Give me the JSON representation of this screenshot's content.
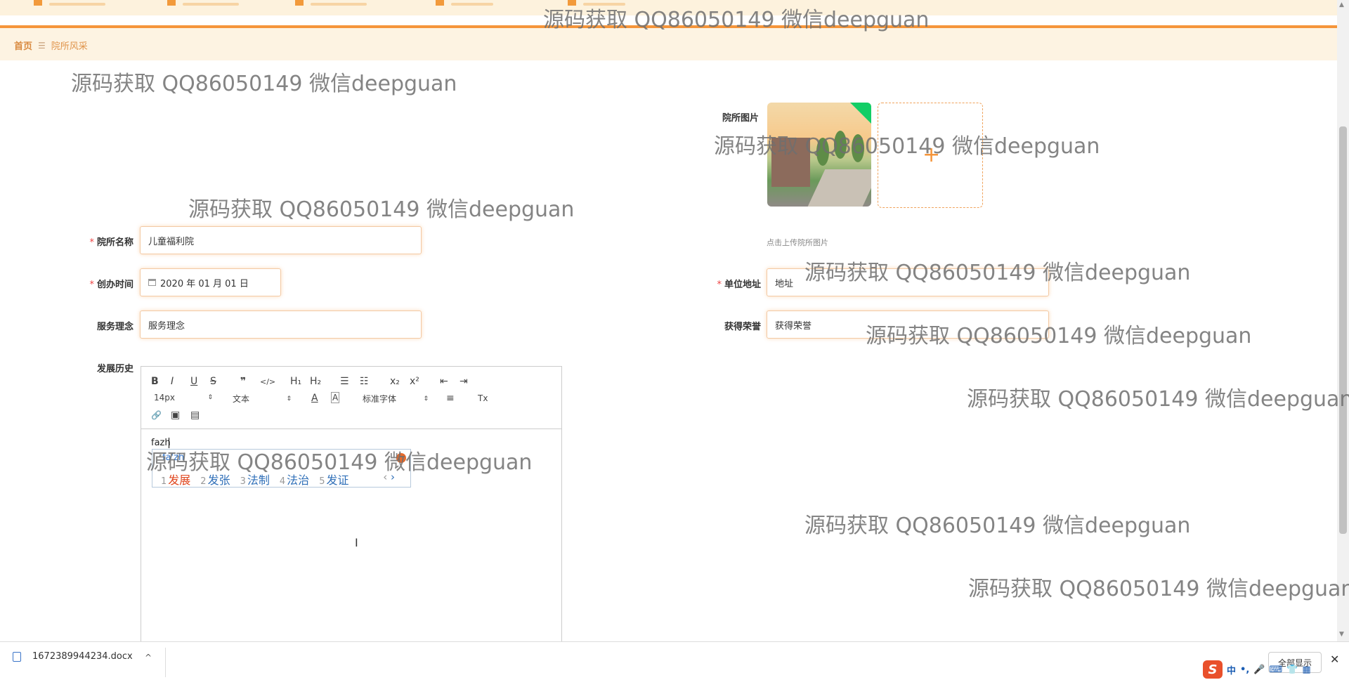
{
  "nav": {
    "items": [
      "",
      "",
      "",
      "",
      ""
    ]
  },
  "breadcrumb": {
    "home": "首页",
    "separator": "☰",
    "current": "院所风采"
  },
  "form": {
    "name": {
      "label": "院所名称",
      "value": "儿童福利院",
      "required": "*"
    },
    "founded": {
      "label": "创办时间",
      "value": "2020 年 01 月 01 日",
      "required": "*"
    },
    "address": {
      "label": "单位地址",
      "value": "地址",
      "required": "*"
    },
    "philosophy": {
      "label": "服务理念",
      "value": "服务理念"
    },
    "honors": {
      "label": "获得荣誉",
      "value": "获得荣誉"
    },
    "photo": {
      "label": "院所图片",
      "tip": "点击上传院所图片",
      "add": "+"
    },
    "history": {
      "label": "发展历史",
      "content": "fazh"
    }
  },
  "editor": {
    "toolbar": {
      "bold": "B",
      "italic": "I",
      "underline": "U",
      "strike": "S",
      "quote": "❞",
      "code": "</>",
      "h1": "H₁",
      "h2": "H₂",
      "ol": "☰",
      "ul": "☷",
      "sub": "x₂",
      "sup": "x²",
      "outdent": "⇤",
      "indent": "⇥",
      "size": "14px",
      "header": "文本",
      "color": "A",
      "bg": "A",
      "font": "标准字体",
      "align": "≡",
      "clean": "Tx",
      "link": "🔗",
      "image": "▣",
      "video": "▤",
      "arrows": "⇕"
    }
  },
  "ime": {
    "pinyin": "fa'zh",
    "candidates": [
      {
        "n": "1",
        "w": "发展"
      },
      {
        "n": "2",
        "w": "发张"
      },
      {
        "n": "3",
        "w": "法制"
      },
      {
        "n": "4",
        "w": "法治"
      },
      {
        "n": "5",
        "w": "发证"
      }
    ],
    "prev": "‹",
    "next": "›"
  },
  "download": {
    "filename": "1672389944234.docx",
    "chevron": "^",
    "show_all": "全部显示",
    "close": "✕"
  },
  "tray": {
    "ime_logo": "S",
    "lang": "中",
    "punct": "•,",
    "mic": "🎤",
    "keyboard": "⌨",
    "shirt": "👕",
    "grid": "▦"
  },
  "watermark": "源码获取 QQ86050149 微信deepguan",
  "colors": {
    "accent": "#f5953a",
    "breadcrumb_bg": "#fdf3e2",
    "required": "#e44444",
    "upload_corner": "#13ce66"
  }
}
